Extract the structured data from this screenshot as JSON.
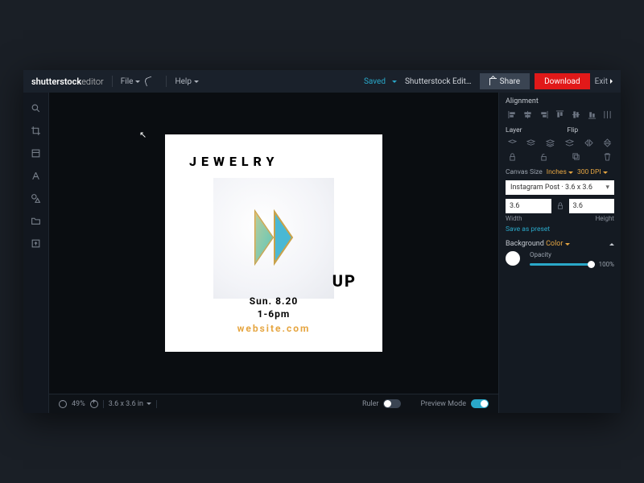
{
  "brand": {
    "name": "shutterstock",
    "product": "editor"
  },
  "menu": {
    "file": "File",
    "help": "Help"
  },
  "doc": {
    "status": "Saved",
    "name": "Shutterstock Edit…"
  },
  "actions": {
    "share": "Share",
    "download": "Download",
    "exit": "Exit"
  },
  "canvas": {
    "headline": "JEWELRY",
    "sub": "UP",
    "date": "Sun. 8.20",
    "time": "1-6pm",
    "site": "website.com"
  },
  "status": {
    "zoom": "49%",
    "dims": "3.6 x 3.6 in",
    "ruler": "Ruler",
    "preview": "Preview Mode"
  },
  "panel": {
    "alignment": "Alignment",
    "layer": "Layer",
    "flip": "Flip",
    "canvasSize": "Canvas Size",
    "unit": "Inches",
    "dpi": "300 DPI",
    "preset": "Instagram Post · 3.6 x 3.6",
    "width": "3.6",
    "height": "3.6",
    "widthLabel": "Width",
    "heightLabel": "Height",
    "savePreset": "Save as preset",
    "background": "Background",
    "bgMode": "Color",
    "opacity": "Opacity",
    "opacityVal": "100%"
  }
}
